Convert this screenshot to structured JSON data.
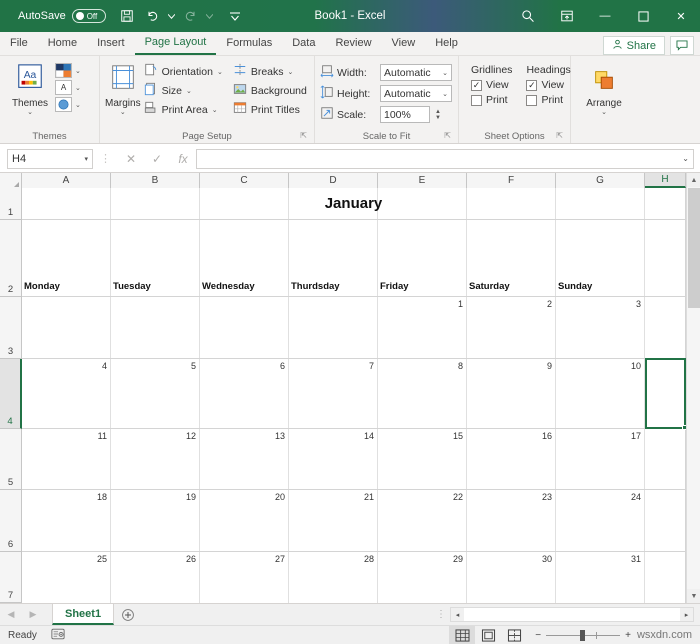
{
  "titlebar": {
    "autosave_label": "AutoSave",
    "autosave_state": "Off",
    "save_icon": "save-icon",
    "undo_icon": "undo-icon",
    "redo_icon": "redo-icon",
    "customize_icon": "customize-quick-access-icon",
    "document_title": "Book1  -  Excel",
    "search_icon": "search-icon",
    "ribbon_display_icon": "ribbon-display-options-icon",
    "minimize_label": "—",
    "maximize_label": "☐",
    "close_label": "✕"
  },
  "tabs": {
    "items": [
      {
        "label": "File",
        "active": false
      },
      {
        "label": "Home",
        "active": false
      },
      {
        "label": "Insert",
        "active": false
      },
      {
        "label": "Page Layout",
        "active": true
      },
      {
        "label": "Formulas",
        "active": false
      },
      {
        "label": "Data",
        "active": false
      },
      {
        "label": "Review",
        "active": false
      },
      {
        "label": "View",
        "active": false
      },
      {
        "label": "Help",
        "active": false
      }
    ],
    "share_label": "Share",
    "share_icon": "share-person-icon",
    "comment_icon": "comment-icon"
  },
  "ribbon": {
    "groups": [
      {
        "name": "Themes",
        "label": "Themes",
        "themes_button": {
          "label": "Themes",
          "icon": "themes-aa-icon",
          "chevron": "⌄"
        },
        "small_items": [
          {
            "name": "colors",
            "icon": "theme-colors-icon",
            "chevron": "⌄"
          },
          {
            "name": "fonts",
            "icon": "theme-fonts-icon",
            "glyph": "A",
            "chevron": "⌄"
          },
          {
            "name": "effects",
            "icon": "theme-effects-icon",
            "chevron": "⌄"
          }
        ]
      },
      {
        "name": "Page Setup",
        "label": "Page Setup",
        "margins_button": {
          "label": "Margins",
          "icon": "margins-icon",
          "chevron": "⌄"
        },
        "menu_items": [
          {
            "label": "Orientation",
            "icon": "orientation-icon",
            "chevron": "⌄"
          },
          {
            "label": "Size",
            "icon": "size-icon",
            "chevron": "⌄"
          },
          {
            "label": "Print Area",
            "icon": "print-area-icon",
            "chevron": "⌄"
          },
          {
            "label": "Breaks",
            "icon": "breaks-icon",
            "chevron": "⌄"
          },
          {
            "label": "Background",
            "icon": "background-icon",
            "chevron": ""
          },
          {
            "label": "Print Titles",
            "icon": "print-titles-icon",
            "chevron": ""
          }
        ],
        "dialog_launcher": "dialog-launcher-icon"
      },
      {
        "name": "Scale to Fit",
        "label": "Scale to Fit",
        "rows": [
          {
            "label": "Width:",
            "value": "Automatic",
            "icon": "fit-width-icon",
            "chevron": "⌄"
          },
          {
            "label": "Height:",
            "value": "Automatic",
            "icon": "fit-height-icon",
            "chevron": "⌄"
          },
          {
            "label": "Scale:",
            "value": "100%",
            "icon": "scale-icon",
            "spinner": true
          }
        ],
        "dialog_launcher": "dialog-launcher-icon"
      },
      {
        "name": "Sheet Options",
        "label": "Sheet Options",
        "columns": [
          {
            "head": "Gridlines",
            "checks": [
              {
                "label": "View",
                "checked": true
              },
              {
                "label": "Print",
                "checked": false
              }
            ]
          },
          {
            "head": "Headings",
            "checks": [
              {
                "label": "View",
                "checked": true
              },
              {
                "label": "Print",
                "checked": false
              }
            ]
          }
        ],
        "dialog_launcher": "dialog-launcher-icon"
      },
      {
        "name": "Arrange",
        "label": "",
        "arrange_button": {
          "label": "Arrange",
          "icon": "arrange-icon",
          "chevron": "⌄"
        }
      }
    ]
  },
  "formula_bar": {
    "name_box_value": "H4",
    "name_box_chevron": "▾",
    "cancel_icon": "cancel-x-icon",
    "enter_icon": "enter-check-icon",
    "function_icon": "insert-function-fx-icon",
    "formula_value": "",
    "expand_chevron": "⌄"
  },
  "grid": {
    "columns": [
      "A",
      "B",
      "C",
      "D",
      "E",
      "F",
      "G",
      "H"
    ],
    "selected_column": "H",
    "rows": [
      "1",
      "2",
      "3",
      "4",
      "5",
      "6",
      "7"
    ],
    "selected_row": "4",
    "selected_cell": "H4",
    "calendar": {
      "title": "January",
      "day_names": [
        "Monday",
        "Tuesday",
        "Wednesday",
        "Thurdsday",
        "Friday",
        "Saturday",
        "Sunday"
      ],
      "weeks": [
        [
          "",
          "",
          "",
          "",
          "1",
          "2",
          "3"
        ],
        [
          "4",
          "5",
          "6",
          "7",
          "8",
          "9",
          "10"
        ],
        [
          "11",
          "12",
          "13",
          "14",
          "15",
          "16",
          "17"
        ],
        [
          "18",
          "19",
          "20",
          "21",
          "22",
          "23",
          "24"
        ],
        [
          "25",
          "26",
          "27",
          "28",
          "29",
          "30",
          "31"
        ]
      ]
    }
  },
  "sheetbar": {
    "prev_icon": "prev-sheet-arrow-icon",
    "next_icon": "next-sheet-arrow-icon",
    "sheet_tab": "Sheet1",
    "add_sheet_icon": "add-sheet-plus-icon",
    "hscroll_left_icon": "◂",
    "hscroll_right_icon": "▸"
  },
  "statusbar": {
    "status_text": "Ready",
    "accessibility_icon": "accessibility-checker-icon",
    "view_normal_icon": "normal-view-icon",
    "view_pagelayout_icon": "page-layout-view-icon",
    "view_pagebreak_icon": "page-break-preview-icon",
    "zoom_out_label": "−",
    "zoom_in_label": "+",
    "watermark": "wsxdn.com"
  },
  "theme": {
    "excel_green": "#217346",
    "ribbon_bg": "#f3f2f1",
    "gridline": "#e0e0e0"
  }
}
